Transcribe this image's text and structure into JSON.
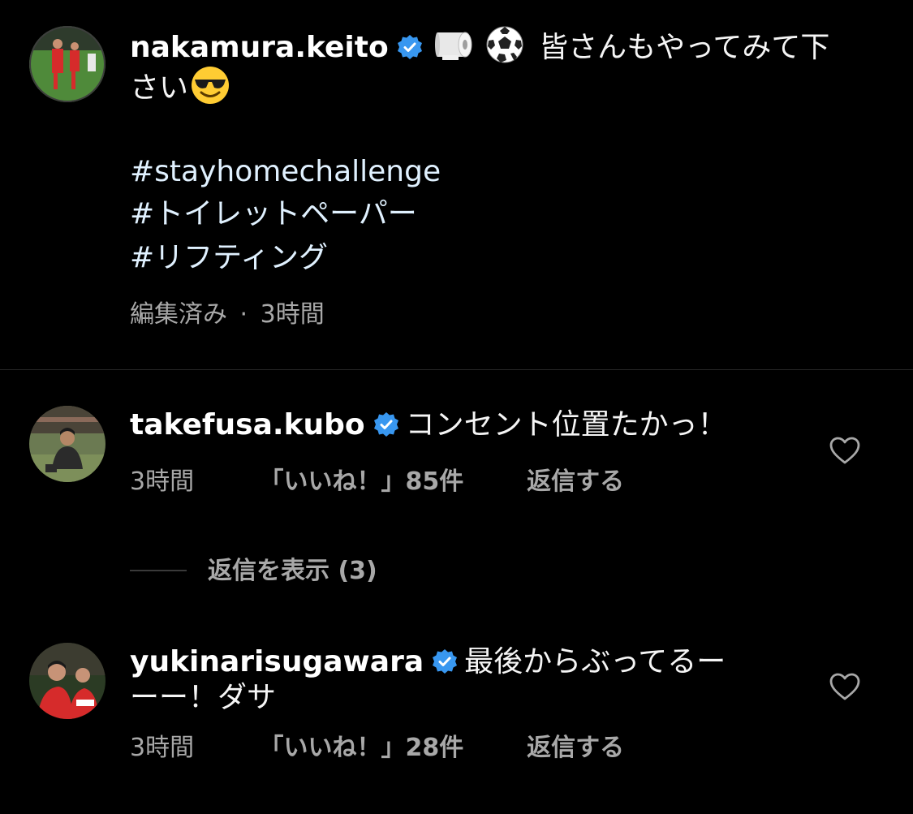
{
  "post": {
    "username": "nakamura.keito",
    "caption_line1": "皆さんもやってみて下",
    "caption_line2": "さい",
    "hashtags": [
      "#stayhomechallenge",
      "#トイレットペーパー",
      "#リフティング"
    ],
    "edited": "編集済み",
    "separator": "·",
    "time": "3時間",
    "emojis": [
      "toilet-paper-emoji",
      "soccer-ball-emoji",
      "sunglasses-smile-emoji"
    ]
  },
  "comments": [
    {
      "username": "takefusa.kubo",
      "text_line1": "コンセント位置たかっ！",
      "time": "3時間",
      "likes": "「いいね！」85件",
      "reply": "返信する",
      "view_replies": "返信を表示 (3)"
    },
    {
      "username": "yukinarisugawara",
      "text_line1": "最後からぶってるー",
      "text_line2": "ーー！ダサ",
      "time": "3時間",
      "likes": "「いいね！」28件",
      "reply": "返信する"
    }
  ],
  "colors": {
    "background": "#000000",
    "verified": "#3897f0",
    "secondary_text": "#a8a8a8",
    "hashtag": "#e0f1ff"
  }
}
